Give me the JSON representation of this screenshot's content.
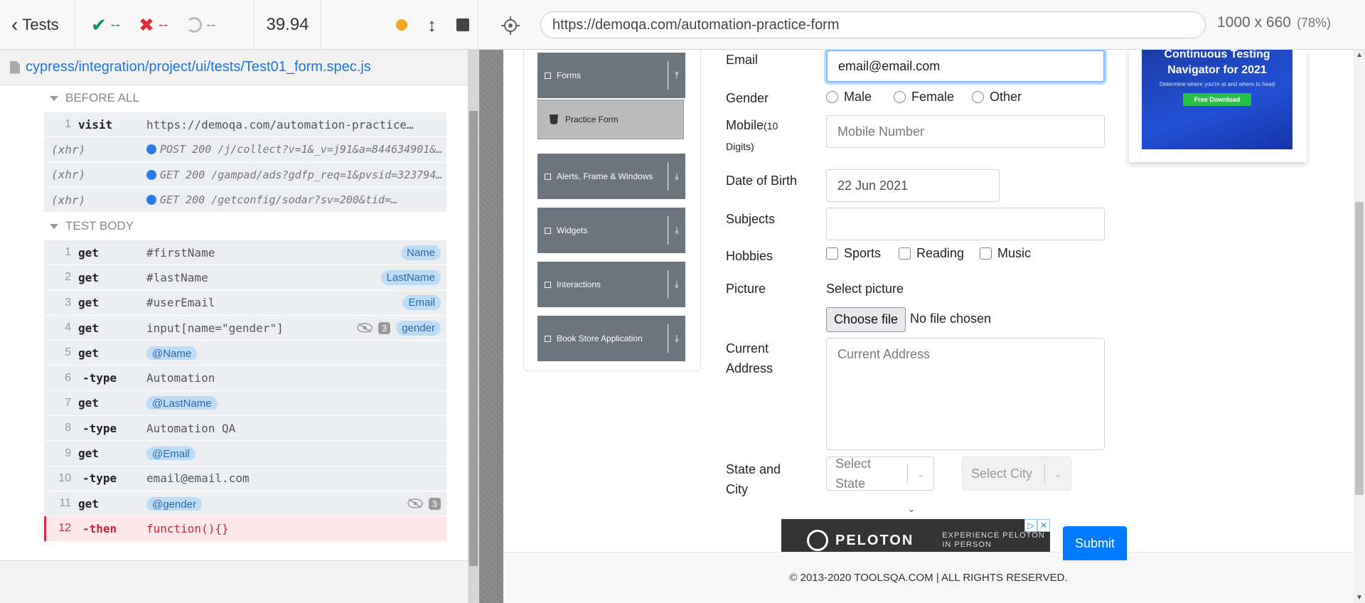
{
  "topbar": {
    "back_label": "Tests",
    "passed": "--",
    "failed": "--",
    "pending": "--",
    "duration": "39.94",
    "url": "https://demoqa.com/automation-practice-form",
    "viewport": "1000 x 660",
    "zoom": "(78%)"
  },
  "reporter": {
    "spec_path": "cypress/integration/project/ui/tests/Test01_form.spec.js",
    "before_all_label": "BEFORE ALL",
    "test_body_label": "TEST BODY",
    "before_all": [
      {
        "num": "1",
        "cmd": "visit",
        "msg": "https://demoqa.com/automation-practice…"
      },
      {
        "num": "",
        "cmd": "(xhr)",
        "msg": "POST 200 /j/collect?v=1&_v=j91&a=844634901&…"
      },
      {
        "num": "",
        "cmd": "(xhr)",
        "msg": "GET 200 /gampad/ads?gdfp_req=1&pvsid=323794…"
      },
      {
        "num": "",
        "cmd": "(xhr)",
        "msg": "GET 200 /getconfig/sodar?sv=200&tid=…"
      }
    ],
    "test_body": [
      {
        "num": "1",
        "cmd": "get",
        "msg": "#firstName",
        "alias": "Name"
      },
      {
        "num": "2",
        "cmd": "get",
        "msg": "#lastName",
        "alias": "LastName"
      },
      {
        "num": "3",
        "cmd": "get",
        "msg": "#userEmail",
        "alias": "Email"
      },
      {
        "num": "4",
        "cmd": "get",
        "msg": "input[name=\"gender\"]",
        "count": "3",
        "alias": "gender"
      },
      {
        "num": "5",
        "cmd": "get",
        "chip": "@Name"
      },
      {
        "num": "6",
        "cmd": "-type",
        "msg": "Automation"
      },
      {
        "num": "7",
        "cmd": "get",
        "chip": "@LastName"
      },
      {
        "num": "8",
        "cmd": "-type",
        "msg": "Automation QA"
      },
      {
        "num": "9",
        "cmd": "get",
        "chip": "@Email"
      },
      {
        "num": "10",
        "cmd": "-type",
        "msg": "email@email.com"
      },
      {
        "num": "11",
        "cmd": "get",
        "chip": "@gender",
        "count": "3"
      },
      {
        "num": "12",
        "cmd": "-then",
        "msg": "function(){}"
      }
    ]
  },
  "sidebar": {
    "groups": [
      {
        "label": "Forms"
      },
      {
        "label": "Alerts, Frame & Windows"
      },
      {
        "label": "Widgets"
      },
      {
        "label": "Interactions"
      },
      {
        "label": "Book Store Application"
      }
    ],
    "active_item": "Practice Form"
  },
  "form": {
    "email_label": "Email",
    "email_value": "email@email.com",
    "gender_label": "Gender",
    "gender_options": [
      "Male",
      "Female",
      "Other"
    ],
    "mobile_label": "Mobile",
    "mobile_hint": "(10",
    "mobile_hint2": "Digits)",
    "mobile_placeholder": "Mobile Number",
    "dob_label": "Date of Birth",
    "dob_value": "22 Jun 2021",
    "subjects_label": "Subjects",
    "hobbies_label": "Hobbies",
    "hobbies": [
      "Sports",
      "Reading",
      "Music"
    ],
    "picture_label": "Picture",
    "select_picture": "Select picture",
    "choose_file": "Choose file",
    "no_file": "No file chosen",
    "address_label_1": "Current",
    "address_label_2": "Address",
    "address_placeholder": "Current Address",
    "state_label_1": "State and",
    "state_label_2": "City",
    "state_placeholder_1": "Select",
    "state_placeholder_2": "State",
    "city_placeholder": "Select City",
    "submit": "Submit"
  },
  "ads": {
    "top_title": "Continuous Testing Navigator for 2021",
    "top_sub": "Determine where you're at and where to head",
    "top_button": "Free Download",
    "bottom_brand": "PELOTON",
    "bottom_tag_1": "EXPERIENCE PELOTON",
    "bottom_tag_2": "IN PERSON"
  },
  "footer": "© 2013-2020 TOOLSQA.COM | ALL RIGHTS RESERVED.",
  "colors": {
    "pass": "#1b8f5a",
    "fail": "#e0293b",
    "link": "#1a73e8",
    "primary": "#007bff",
    "sidebar": "#6c757d"
  }
}
